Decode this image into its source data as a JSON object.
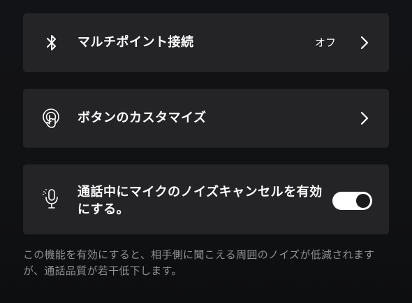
{
  "settings": {
    "multipoint": {
      "icon": "bluetooth-icon",
      "label": "マルチポイント接続",
      "value": "オフ"
    },
    "button_customize": {
      "icon": "touch-gesture-icon",
      "label": "ボタンのカスタマイズ"
    },
    "noise_reduction": {
      "icon": "microphone-icon",
      "label": "通話中にマイクのノイズキャンセルを有効にする。",
      "enabled": true
    }
  },
  "description": "この機能を有効にすると、相手側に聞こえる周囲のノイズが低減されますが、通話品質が若干低下します。"
}
